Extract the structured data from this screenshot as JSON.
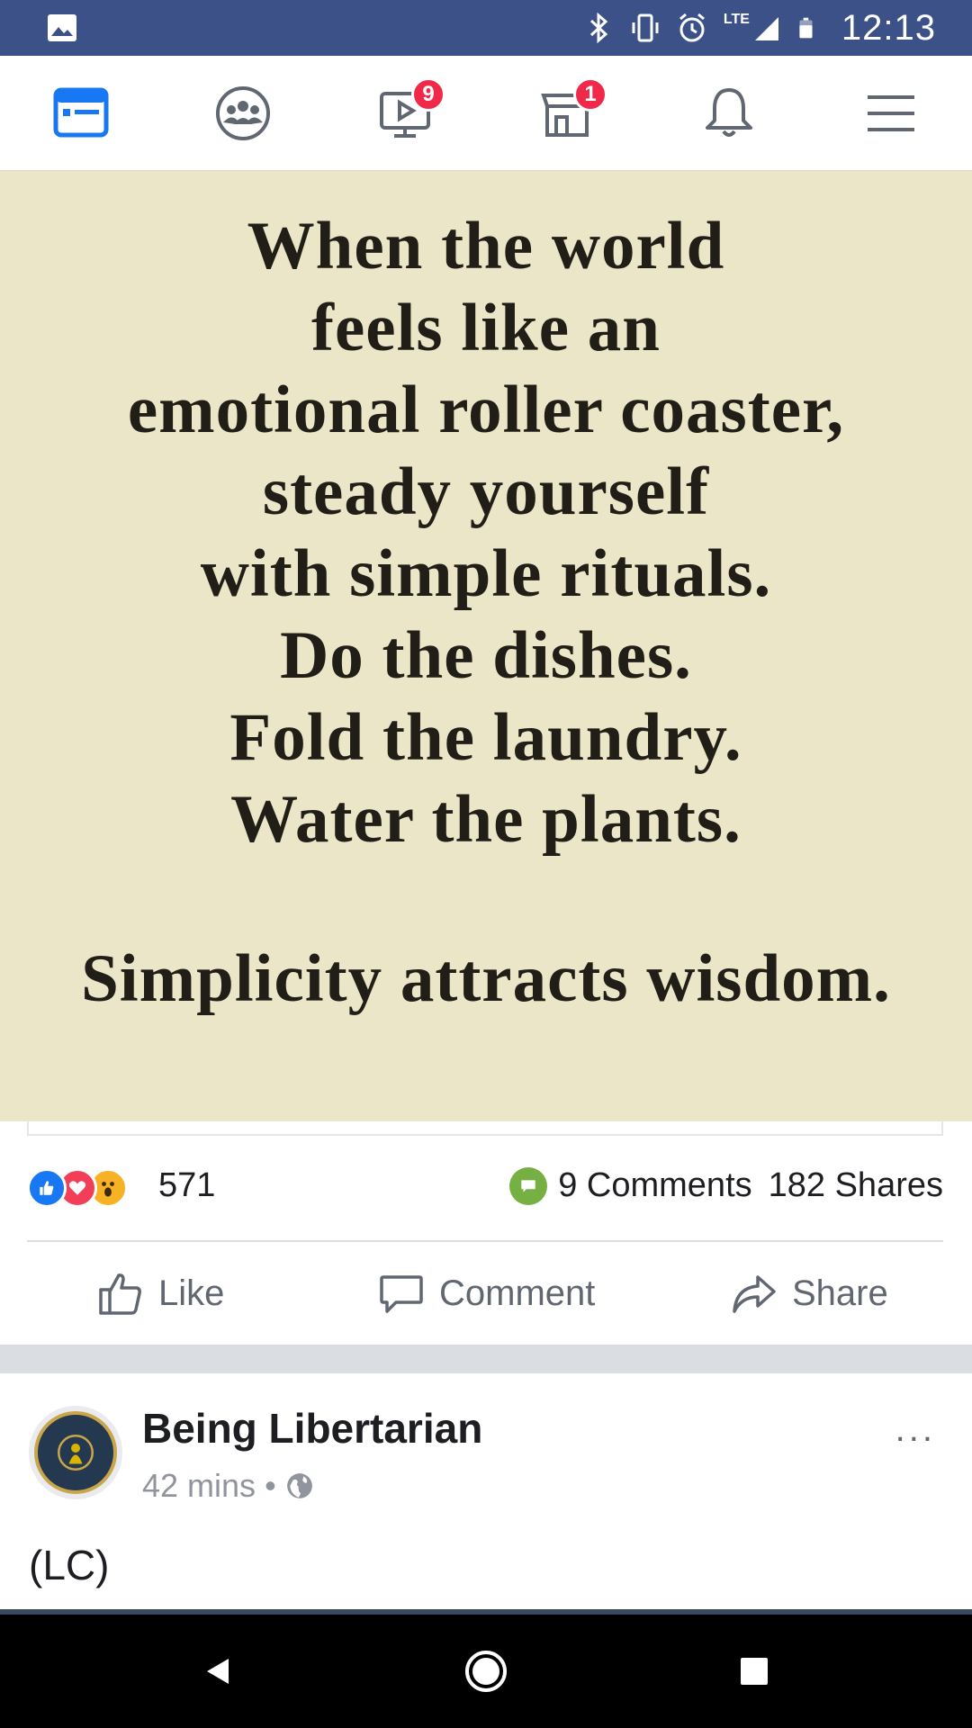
{
  "status_bar": {
    "time": "12:13",
    "network_label": "LTE",
    "icons": [
      "gallery-icon",
      "bluetooth-icon",
      "vibrate-icon",
      "alarm-icon",
      "signal-icon",
      "battery-icon"
    ]
  },
  "top_nav": {
    "items": [
      {
        "name": "news-feed-icon",
        "active": true
      },
      {
        "name": "groups-icon"
      },
      {
        "name": "watch-icon",
        "badge": "9"
      },
      {
        "name": "marketplace-icon",
        "badge": "1"
      },
      {
        "name": "notifications-icon"
      },
      {
        "name": "menu-icon"
      }
    ],
    "active_color": "#1877f2",
    "icon_color": "#606770",
    "badge_color": "#f02849"
  },
  "quote": {
    "lines": [
      "When the world",
      "feels like an",
      "emotional roller coaster,",
      "steady yourself",
      "with simple rituals.",
      "Do the dishes.",
      "Fold the laundry.",
      "Water the plants."
    ],
    "footer": "Simplicity attracts wisdom.",
    "background": "#ebe6c7"
  },
  "reactions": {
    "types": [
      "like",
      "love",
      "wow"
    ],
    "count": "571",
    "comments": "9 Comments",
    "shares": "182 Shares"
  },
  "actions": {
    "like": "Like",
    "comment": "Comment",
    "share": "Share"
  },
  "next_post": {
    "page_name": "Being Libertarian",
    "time": "42 mins",
    "separator": "•",
    "privacy_icon": "globe-icon",
    "more": "...",
    "text": "(LC)"
  },
  "android_nav": [
    "back-icon",
    "home-icon",
    "recents-icon"
  ]
}
